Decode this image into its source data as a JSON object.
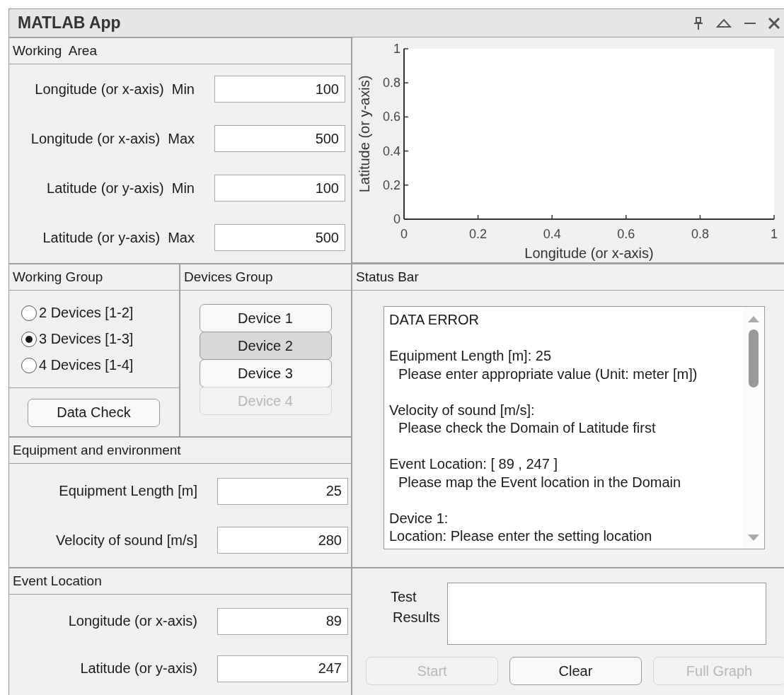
{
  "window": {
    "title": "MATLAB App"
  },
  "working_area": {
    "title": "Working  Area",
    "fields": [
      {
        "label": "Longitude (or x-axis)  Min",
        "value": "100"
      },
      {
        "label": "Longitude (or x-axis)  Max",
        "value": "500"
      },
      {
        "label": "Latitude (or y-axis)  Min",
        "value": "100"
      },
      {
        "label": "Latitude (or y-axis)  Max",
        "value": "500"
      }
    ]
  },
  "chart": {
    "chart_data": {
      "type": "line",
      "xlabel": "Longitude (or x-axis)",
      "ylabel": "Latitude (or y-axis)",
      "xlim": [
        0,
        1
      ],
      "ylim": [
        0,
        1
      ],
      "xticks": [
        {
          "value": 0,
          "label": "0"
        },
        {
          "value": 0.2,
          "label": "0.2"
        },
        {
          "value": 0.4,
          "label": "0.4"
        },
        {
          "value": 0.6,
          "label": "0.6"
        },
        {
          "value": 0.8,
          "label": "0.8"
        },
        {
          "value": 1,
          "label": "1"
        }
      ],
      "yticks": [
        {
          "value": 0,
          "label": "0"
        },
        {
          "value": 0.2,
          "label": "0.2"
        },
        {
          "value": 0.4,
          "label": "0.4"
        },
        {
          "value": 0.6,
          "label": "0.6"
        },
        {
          "value": 0.8,
          "label": "0.8"
        },
        {
          "value": 1,
          "label": "1"
        }
      ]
    }
  },
  "working_group": {
    "title": "Working Group",
    "options": [
      {
        "label": "2 Devices [1-2]",
        "selected": false
      },
      {
        "label": "3 Devices [1-3]",
        "selected": true
      },
      {
        "label": "4 Devices [1-4]",
        "selected": false
      }
    ],
    "button": "Data Check"
  },
  "devices_group": {
    "title": "Devices Group",
    "devices": [
      {
        "label": "Device 1",
        "selected": false,
        "disabled": false
      },
      {
        "label": "Device 2",
        "selected": true,
        "disabled": false
      },
      {
        "label": "Device 3",
        "selected": false,
        "disabled": false
      },
      {
        "label": "Device 4",
        "selected": false,
        "disabled": true
      }
    ]
  },
  "status_bar": {
    "title": "Status Bar",
    "blocks": [
      {
        "lines": [
          {
            "text": "DATA ERROR",
            "indent": false
          }
        ]
      },
      {
        "lines": [
          {
            "text": "Equipment Length [m]: 25",
            "indent": false
          },
          {
            "text": "Please enter appropriate value (Unit: meter [m])",
            "indent": true
          }
        ]
      },
      {
        "lines": [
          {
            "text": "Velocity of sound [m/s]:",
            "indent": false
          },
          {
            "text": "Please check the Domain of Latitude first",
            "indent": true
          }
        ]
      },
      {
        "lines": [
          {
            "text": "Event Location: [ 89 , 247 ]",
            "indent": false
          },
          {
            "text": "Please map the Event location in the Domain",
            "indent": true
          }
        ]
      },
      {
        "lines": [
          {
            "text": "Device 1:",
            "indent": false
          },
          {
            "text": "Location: Please enter the setting location",
            "indent": false
          }
        ]
      }
    ]
  },
  "equipment": {
    "title": "Equipment and environment",
    "fields": [
      {
        "label": "Equipment Length [m]",
        "value": "25"
      },
      {
        "label": "Velocity of sound [m/s]",
        "value": "280"
      }
    ]
  },
  "event_location": {
    "title": "Event Location",
    "fields": [
      {
        "label": "Longitude (or x-axis)",
        "value": "89"
      },
      {
        "label": "Latitude (or y-axis)",
        "value": "247"
      }
    ]
  },
  "test": {
    "label_lines": [
      "Test",
      "Results"
    ],
    "buttons": [
      {
        "label": "Start",
        "disabled": true
      },
      {
        "label": "Clear",
        "disabled": false
      },
      {
        "label": "Full Graph",
        "disabled": true
      }
    ]
  }
}
